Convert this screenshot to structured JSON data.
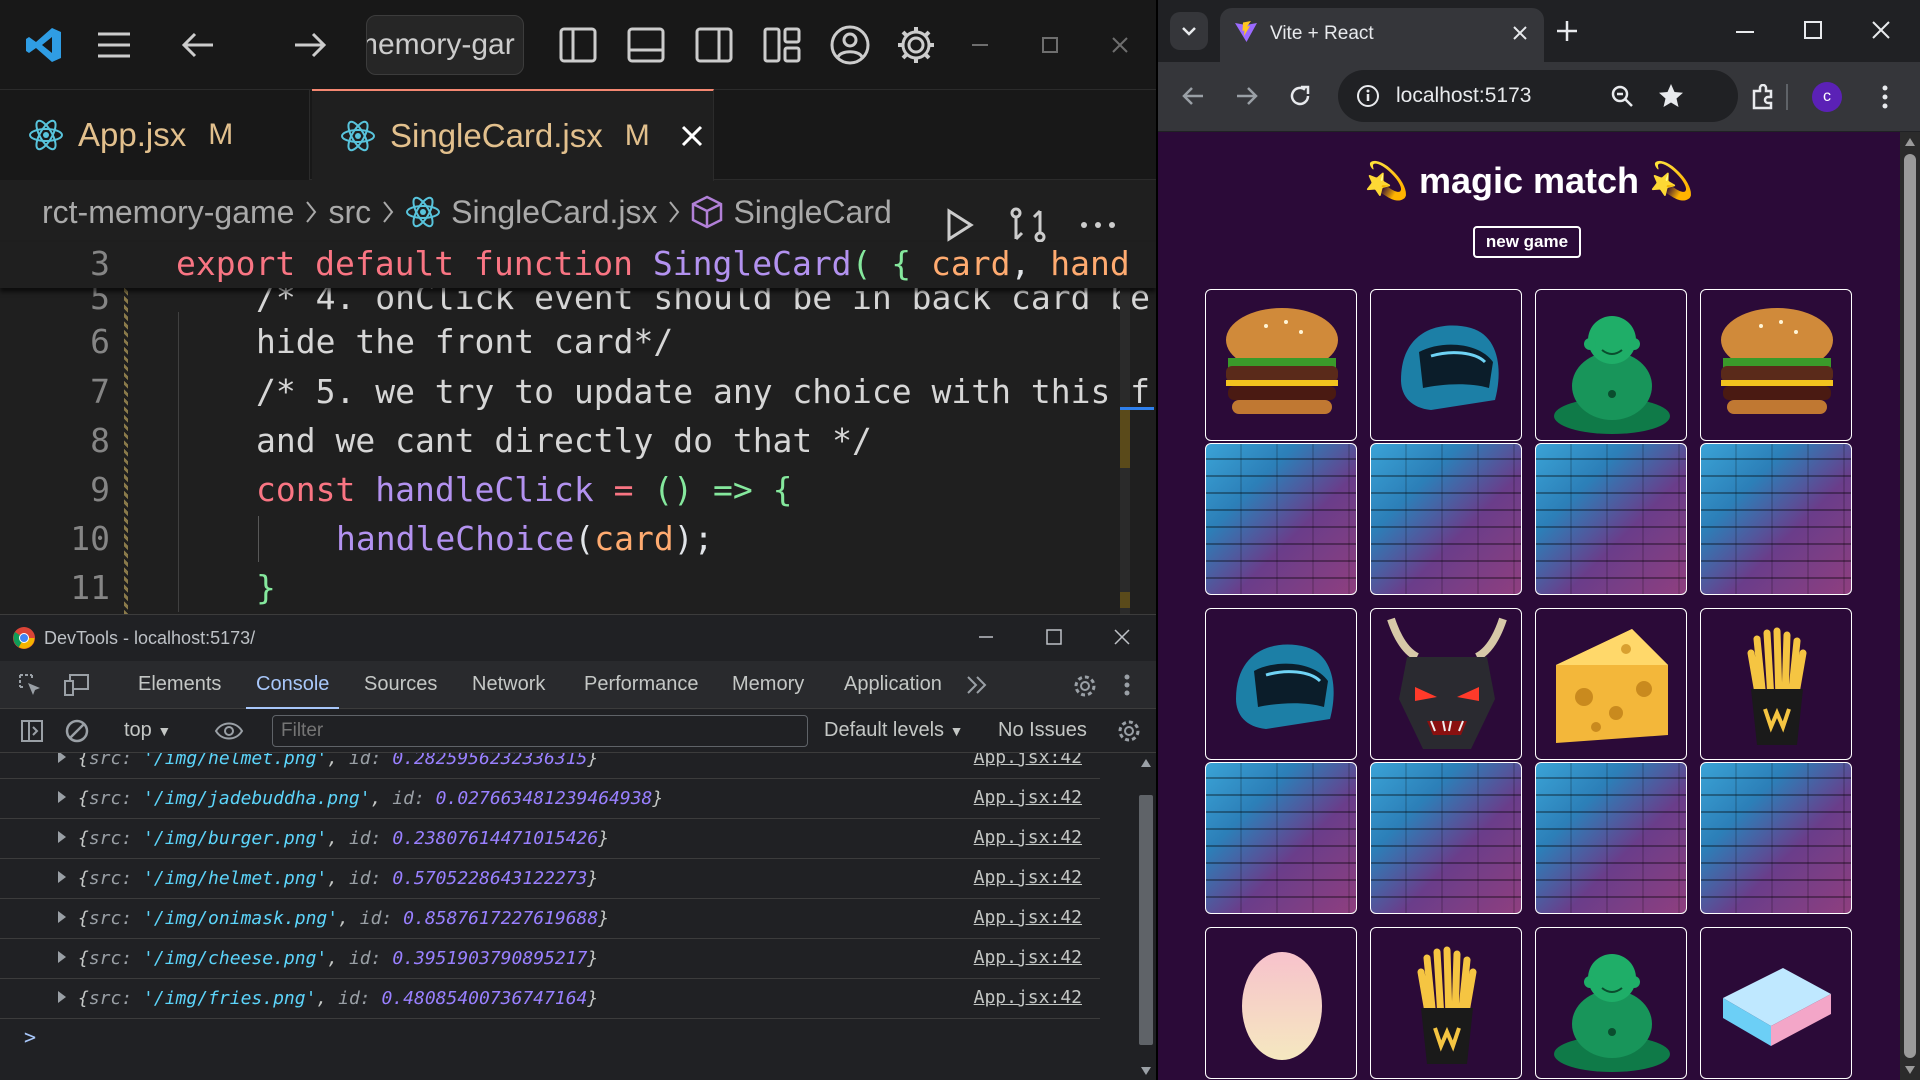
{
  "vscode": {
    "search_text": "memory-gar",
    "tabs": [
      {
        "label": "App.jsx",
        "status": "M"
      },
      {
        "label": "SingleCard.jsx",
        "status": "M"
      }
    ],
    "breadcrumb": [
      "rct-memory-game",
      "src",
      "SingleCard.jsx",
      "SingleCard"
    ],
    "sticky_line": {
      "num": "3",
      "kw1": "export",
      "kw2": "default",
      "kw3": "function",
      "fn": "SingleCard",
      "rest": "( { ",
      "p1": "card",
      "comma": ", ",
      "p2": "hand"
    },
    "lines": [
      {
        "num": "5",
        "text": "/* 4. onClick event should be in back card be"
      },
      {
        "num": "6",
        "text": "hide the front card*/"
      },
      {
        "num": "7",
        "text": "/* 5. we try to update any choice with this f"
      },
      {
        "num": "8",
        "text": "and we cant directly do that */"
      },
      {
        "num": "9",
        "kw": "const",
        "fn": "handleClick",
        "op": " = ",
        "par": "() => {"
      },
      {
        "num": "10",
        "fn": "handleChoice",
        "p": "card",
        "end": ");"
      },
      {
        "num": "11",
        "text": "}"
      }
    ]
  },
  "devtools": {
    "title": "DevTools - localhost:5173/",
    "tabs": [
      "Elements",
      "Console",
      "Sources",
      "Network",
      "Performance",
      "Memory",
      "Application"
    ],
    "context": "top",
    "filter_placeholder": "Filter",
    "levels": "Default levels",
    "issues": "No Issues",
    "prompt": ">",
    "logs": [
      {
        "src": "'/img/helmet.png'",
        "id": "0.2825956232336315",
        "link": "App.jsx:42"
      },
      {
        "src": "'/img/jadebuddha.png'",
        "id": "0.027663481239464938",
        "link": "App.jsx:42"
      },
      {
        "src": "'/img/burger.png'",
        "id": "0.23807614471015426",
        "link": "App.jsx:42"
      },
      {
        "src": "'/img/helmet.png'",
        "id": "0.5705228643122273",
        "link": "App.jsx:42"
      },
      {
        "src": "'/img/onimask.png'",
        "id": "0.8587617227619688",
        "link": "App.jsx:42"
      },
      {
        "src": "'/img/cheese.png'",
        "id": "0.3951903790895217",
        "link": "App.jsx:42"
      },
      {
        "src": "'/img/fries.png'",
        "id": "0.48085400736747164",
        "link": "App.jsx:42"
      }
    ]
  },
  "chrome": {
    "tab_title": "Vite + React",
    "url": "localhost:5173",
    "profile_initial": "c"
  },
  "app": {
    "title": "magic match",
    "emoji": "💫",
    "new_game_label": "new game",
    "cards": [
      {
        "face": "burger-image",
        "flipped": true
      },
      {
        "face": "helmet-image",
        "flipped": true
      },
      {
        "face": "jade-buddha-image",
        "flipped": true
      },
      {
        "face": "burger-image",
        "flipped": true
      },
      {
        "face": "card-back",
        "flipped": false
      },
      {
        "face": "card-back",
        "flipped": false
      },
      {
        "face": "card-back",
        "flipped": false
      },
      {
        "face": "card-back",
        "flipped": false
      },
      {
        "face": "helmet-image",
        "flipped": true
      },
      {
        "face": "oni-mask-image",
        "flipped": true
      },
      {
        "face": "cheese-image",
        "flipped": true
      },
      {
        "face": "fries-image",
        "flipped": true
      },
      {
        "face": "card-back",
        "flipped": false
      },
      {
        "face": "card-back",
        "flipped": false
      },
      {
        "face": "card-back",
        "flipped": false
      },
      {
        "face": "card-back",
        "flipped": false
      },
      {
        "face": "egg-image",
        "flipped": true
      },
      {
        "face": "fries-image",
        "flipped": true
      },
      {
        "face": "jade-buddha-image",
        "flipped": true
      },
      {
        "face": "eraser-image",
        "flipped": true
      }
    ]
  },
  "colors": {
    "vscode_bg": "#1f1f1f",
    "modified": "#e2c08d",
    "react_blue": "#58c4dc",
    "app_bg": "#2b0a38"
  }
}
